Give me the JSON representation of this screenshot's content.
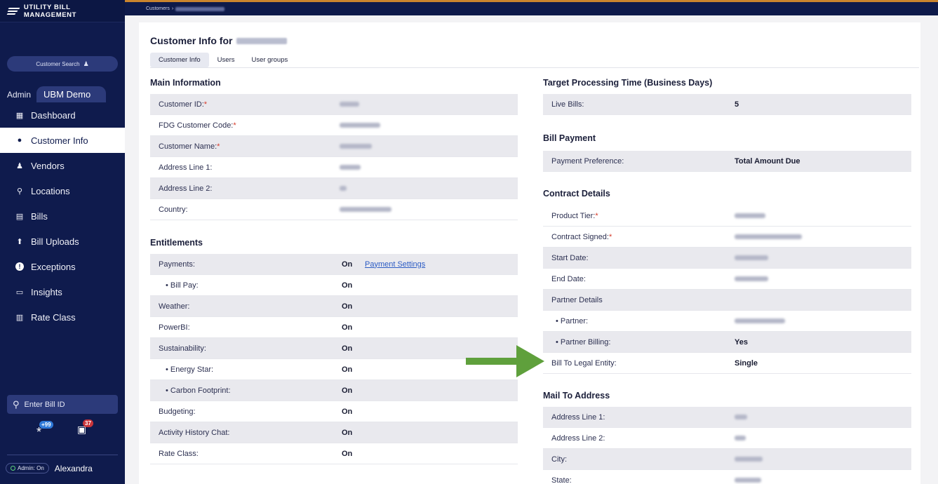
{
  "app": {
    "brand": "UTILITY BILL MANAGEMENT"
  },
  "breadcrumb": {
    "root": "Customers",
    "sep": "›"
  },
  "sidebar": {
    "customer_search": "Customer Search",
    "admin_tab": "Admin",
    "ubm_tab": "UBM Demo",
    "items": [
      {
        "label": "Dashboard",
        "icon": "dashboard-icon",
        "glyph": "▦"
      },
      {
        "label": "Customer Info",
        "icon": "person-icon",
        "glyph": "●"
      },
      {
        "label": "Vendors",
        "icon": "vendor-icon",
        "glyph": "♟"
      },
      {
        "label": "Locations",
        "icon": "location-pin-icon",
        "glyph": "⚲"
      },
      {
        "label": "Bills",
        "icon": "bill-icon",
        "glyph": "▤"
      },
      {
        "label": "Bill Uploads",
        "icon": "upload-icon",
        "glyph": "⬆"
      },
      {
        "label": "Exceptions",
        "icon": "exclamation-icon",
        "glyph": "!"
      },
      {
        "label": "Insights",
        "icon": "insights-icon",
        "glyph": "▭"
      },
      {
        "label": "Rate Class",
        "icon": "rate-class-icon",
        "glyph": "▥"
      }
    ],
    "bill_id_placeholder": "Enter Bill ID",
    "badge_asterisk": "+99",
    "badge_bills": "37",
    "admin_pill": "Admin: On",
    "user_name": "Alexandra"
  },
  "main": {
    "title_prefix": "Customer Info for",
    "tabs": [
      "Customer Info",
      "Users",
      "User groups"
    ],
    "main_information": {
      "title": "Main Information",
      "rows": [
        {
          "label": "Customer ID:",
          "required": "*"
        },
        {
          "label": "FDG Customer Code:",
          "required": "*"
        },
        {
          "label": "Customer Name:",
          "required": "*"
        },
        {
          "label": "Address Line 1:",
          "required": ""
        },
        {
          "label": "Address Line 2:",
          "required": ""
        },
        {
          "label": "Country:",
          "required": ""
        }
      ]
    },
    "entitlements": {
      "title": "Entitlements",
      "payment_settings_link": "Payment Settings",
      "rows": [
        {
          "label": "Payments:",
          "value": "On"
        },
        {
          "label": "• Bill Pay:",
          "value": "On"
        },
        {
          "label": "Weather:",
          "value": "On"
        },
        {
          "label": "PowerBI:",
          "value": "On"
        },
        {
          "label": "Sustainability:",
          "value": "On"
        },
        {
          "label": "• Energy Star:",
          "value": "On"
        },
        {
          "label": "• Carbon Footprint:",
          "value": "On"
        },
        {
          "label": "Budgeting:",
          "value": "On"
        },
        {
          "label": "Activity History Chat:",
          "value": "On"
        },
        {
          "label": "Rate Class:",
          "value": "On"
        }
      ]
    },
    "target_processing": {
      "title": "Target Processing Time (Business Days)",
      "rows": [
        {
          "label": "Live Bills:",
          "value": "5"
        }
      ]
    },
    "bill_payment": {
      "title": "Bill Payment",
      "rows": [
        {
          "label": "Payment Preference:",
          "value": "Total Amount Due"
        }
      ]
    },
    "contract_details": {
      "title": "Contract Details",
      "rows": [
        {
          "label": "Product Tier:",
          "required": "*",
          "value": ""
        },
        {
          "label": "Contract Signed:",
          "required": "*",
          "value": ""
        },
        {
          "label": "Start Date:",
          "required": "",
          "value": ""
        },
        {
          "label": "End Date:",
          "required": "",
          "value": ""
        },
        {
          "label": "Partner Details",
          "required": "",
          "value": ""
        },
        {
          "label": "• Partner:",
          "required": "",
          "value": ""
        },
        {
          "label": "• Partner Billing:",
          "required": "",
          "value": "Yes"
        },
        {
          "label": "Bill To Legal Entity:",
          "required": "",
          "value": "Single"
        }
      ]
    },
    "mail_to_address": {
      "title": "Mail To Address",
      "rows": [
        {
          "label": "Address Line 1:"
        },
        {
          "label": "Address Line 2:"
        },
        {
          "label": "City:"
        },
        {
          "label": "State:"
        }
      ]
    }
  },
  "colors": {
    "sidebar": "#0f1b4d",
    "accent_bar": "#c9842d",
    "arrow": "#5fa03c",
    "required": "#d53a2a",
    "link": "#2b5bc4"
  }
}
